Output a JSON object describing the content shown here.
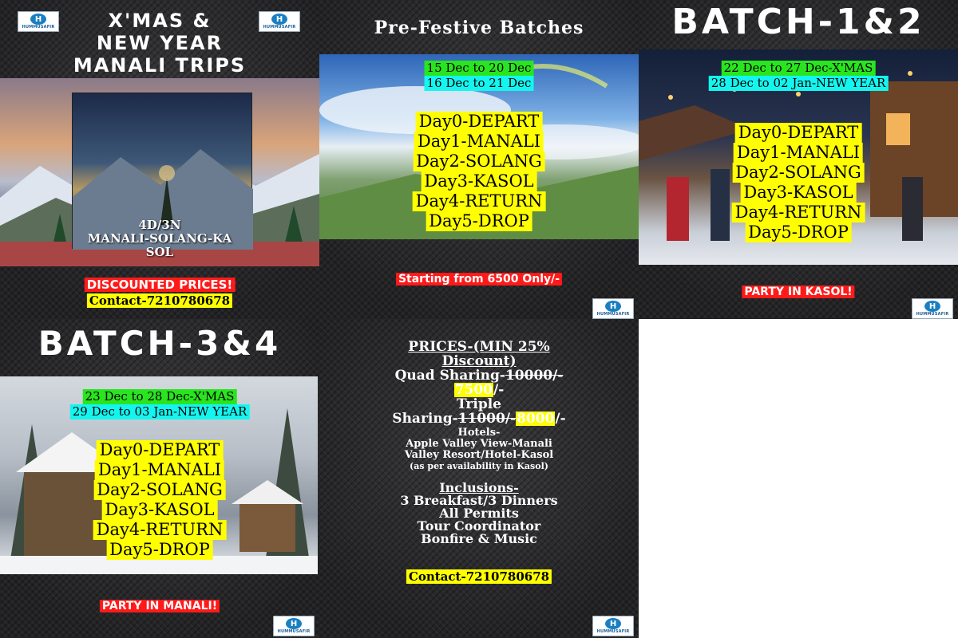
{
  "brand": {
    "logo_text": "HUMMUSAFIR",
    "logo_mark": "H"
  },
  "panel1": {
    "title_lines": [
      "X'MAS &",
      "NEW YEAR",
      "MANALI TRIPS"
    ],
    "duration": "4D/3N",
    "route": "MANALI-SOLANG-KA",
    "route_cont": "SOL",
    "discount": "DISCOUNTED PRICES!",
    "contact": "Contact-7210780678"
  },
  "panel2": {
    "title": "Pre-Festive Batches",
    "dates": [
      "15 Dec to 20 Dec",
      "16 Dec to 21 Dec"
    ],
    "days": [
      "Day0-DEPART",
      "Day1-MANALI",
      "Day2-SOLANG",
      "Day3-KASOL",
      "Day4-RETURN",
      "Day5-DROP"
    ],
    "starting": "Starting from 6500 Only/-"
  },
  "panel3": {
    "title": "BATCH-1&2",
    "dates": [
      "22 Dec to 27 Dec-X'MAS",
      "28 Dec to 02 Jan-NEW YEAR"
    ],
    "days": [
      "Day0-DEPART",
      "Day1-MANALI",
      "Day2-SOLANG",
      "Day3-KASOL",
      "Day4-RETURN",
      "Day5-DROP"
    ],
    "party": "PARTY IN KASOL!"
  },
  "panel4": {
    "title": "BATCH-3&4",
    "dates": [
      "23 Dec to 28 Dec-X'MAS",
      "29 Dec to 03 Jan-NEW YEAR"
    ],
    "days": [
      "Day0-DEPART",
      "Day1-MANALI",
      "Day2-SOLANG",
      "Day3-KASOL",
      "Day4-RETURN",
      "Day5-DROP"
    ],
    "party": "PARTY IN MANALI!"
  },
  "panel5": {
    "prices_heading": "PRICES-(MIN 25%",
    "prices_heading2": "Discount)",
    "quad_label": "Quad Sharing-",
    "quad_old": "10000/-",
    "quad_new": "7500",
    "quad_suffix": "/-",
    "triple_label": "Triple",
    "triple_label2": "Sharing-",
    "triple_old": "11000/-",
    "triple_new": "8000",
    "triple_suffix": "/-",
    "hotels": "Hotels-",
    "hotel1": "Apple Valley View-Manali",
    "hotel2": "Valley Resort/Hotel-Kasol",
    "availability": "(as per availability in Kasol)",
    "inclusions_heading": "Inclusions-",
    "inclusions": [
      "3 Breakfast/3 Dinners",
      "All Permits",
      "Tour Coordinator",
      "Bonfire & Music"
    ],
    "contact": "Contact-7210780678"
  }
}
